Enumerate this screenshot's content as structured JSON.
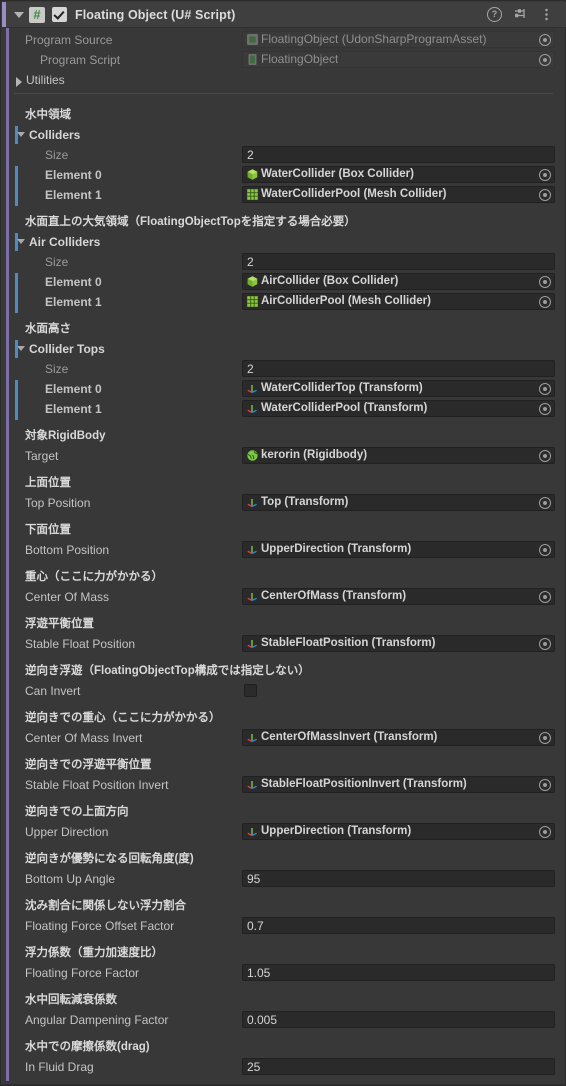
{
  "component": {
    "title": "Floating Object (U# Script)",
    "enabled_checkbox": true,
    "expanded": true,
    "icons": {
      "help": "help-icon",
      "preset": "preset-icon",
      "menu": "kebab-menu-icon"
    }
  },
  "top_fields": [
    {
      "label": "Program Source",
      "value": "FloatingObject (UdonSharpProgramAsset)",
      "icon": "program-asset-icon",
      "disabled": true
    },
    {
      "label": "Program Script",
      "value": "FloatingObject",
      "icon": "script-asset-icon",
      "disabled": true
    }
  ],
  "utilities": {
    "label": "Utilities",
    "expanded": false
  },
  "sections": [
    {
      "jp_header": "水中領域",
      "group_label": "Colliders",
      "size": {
        "label": "Size",
        "value": "2"
      },
      "elements": [
        {
          "label": "Element 0",
          "value": "WaterCollider (Box Collider)",
          "icon": "box-collider-icon"
        },
        {
          "label": "Element 1",
          "value": "WaterColliderPool (Mesh Collider)",
          "icon": "mesh-collider-icon"
        }
      ]
    },
    {
      "jp_header": "水面直上の大気領域（FloatingObjectTopを指定する場合必要）",
      "group_label": "Air Colliders",
      "size": {
        "label": "Size",
        "value": "2"
      },
      "elements": [
        {
          "label": "Element 0",
          "value": "AirCollider (Box Collider)",
          "icon": "box-collider-icon"
        },
        {
          "label": "Element 1",
          "value": "AirColliderPool (Mesh Collider)",
          "icon": "mesh-collider-icon"
        }
      ]
    },
    {
      "jp_header": "水面高さ",
      "group_label": "Collider Tops",
      "size": {
        "label": "Size",
        "value": "2"
      },
      "elements": [
        {
          "label": "Element 0",
          "value": "WaterColliderTop (Transform)",
          "icon": "transform-icon"
        },
        {
          "label": "Element 1",
          "value": "WaterColliderPool (Transform)",
          "icon": "transform-icon"
        }
      ]
    }
  ],
  "properties": [
    {
      "jp_header": "対象RigidBody",
      "label": "Target",
      "type": "object",
      "value": "kerorin (Rigidbody)",
      "icon": "rigidbody-icon"
    },
    {
      "jp_header": "上面位置",
      "label": "Top Position",
      "type": "object",
      "value": "Top (Transform)",
      "icon": "transform-icon"
    },
    {
      "jp_header": "下面位置",
      "label": "Bottom Position",
      "type": "object",
      "value": "UpperDirection (Transform)",
      "icon": "transform-icon"
    },
    {
      "jp_header": "重心（ここに力がかかる）",
      "label": "Center Of Mass",
      "type": "object",
      "value": "CenterOfMass (Transform)",
      "icon": "transform-icon"
    },
    {
      "jp_header": "浮遊平衡位置",
      "label": "Stable Float Position",
      "type": "object",
      "value": "StableFloatPosition (Transform)",
      "icon": "transform-icon"
    },
    {
      "jp_header": "逆向き浮遊（FloatingObjectTop構成では指定しない）",
      "label": "Can Invert",
      "type": "checkbox",
      "value": "",
      "checked": false
    },
    {
      "jp_header": "逆向きでの重心（ここに力がかかる）",
      "label": "Center Of Mass Invert",
      "type": "object",
      "value": "CenterOfMassInvert (Transform)",
      "icon": "transform-icon"
    },
    {
      "jp_header": "逆向きでの浮遊平衡位置",
      "label": "Stable Float Position Invert",
      "type": "object",
      "value": "StableFloatPositionInvert (Transform)",
      "icon": "transform-icon"
    },
    {
      "jp_header": "逆向きでの上面方向",
      "label": "Upper Direction",
      "type": "object",
      "value": "UpperDirection (Transform)",
      "icon": "transform-icon"
    },
    {
      "jp_header": "逆向きが優勢になる回転角度(度)",
      "label": "Bottom Up Angle",
      "type": "number",
      "value": "95"
    },
    {
      "jp_header": "沈み割合に関係しない浮力割合",
      "label": "Floating Force Offset Factor",
      "type": "number",
      "value": "0.7"
    },
    {
      "jp_header": "浮力係数（重力加速度比）",
      "label": "Floating Force Factor",
      "type": "number",
      "value": "1.05"
    },
    {
      "jp_header": "水中回転減衰係数",
      "label": "Angular Dampening Factor",
      "type": "number",
      "value": "0.005"
    },
    {
      "jp_header": "水中での摩擦係数(drag)",
      "label": "In Fluid Drag",
      "type": "number",
      "value": "25"
    }
  ],
  "colors": {
    "panel_bg": "#383838",
    "header_bg": "#3f3f3f",
    "field_bg": "#2a2a2a",
    "accent_purple": "#7e6fa8",
    "accent_blue": "#4e8bc4",
    "text": "#c4c4c4"
  }
}
